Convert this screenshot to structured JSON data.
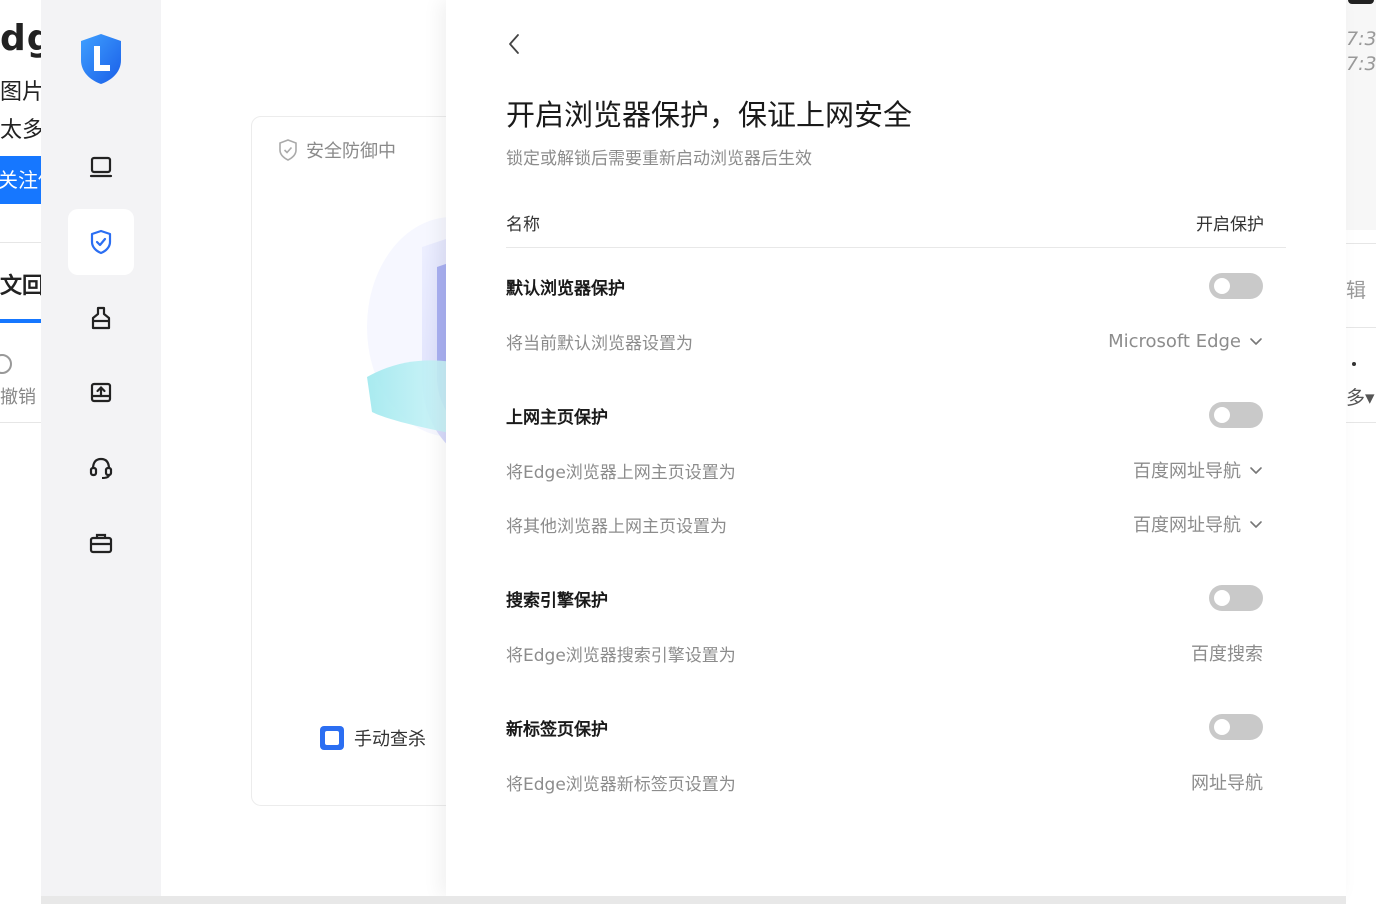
{
  "background_left": {
    "fragment_1": "dge",
    "fragment_2": "图片]",
    "fragment_3": "太多",
    "follow_label": "关注他",
    "fragment_4": "文回答",
    "fragment_5": "撤销"
  },
  "sidebar": {
    "items": [
      {
        "icon": "monitor-icon",
        "active": false
      },
      {
        "icon": "shield-check-icon",
        "active": true
      },
      {
        "icon": "broom-icon",
        "active": false
      },
      {
        "icon": "upload-box-icon",
        "active": false
      },
      {
        "icon": "headset-icon",
        "active": false
      },
      {
        "icon": "toolbox-icon",
        "active": false
      }
    ],
    "accent_color": "#2b6ef2"
  },
  "main_card": {
    "status_label": "安全防御中",
    "manual_scan_label": "手动查杀"
  },
  "panel": {
    "title": "开启浏览器保护，保证上网安全",
    "subtitle": "锁定或解锁后需要重新启动浏览器后生效",
    "header": {
      "name_col": "名称",
      "toggle_col": "开启保护"
    },
    "sections": [
      {
        "title": "默认浏览器保护",
        "enabled": false,
        "rows": [
          {
            "label": "将当前默认浏览器设置为",
            "value": "Microsoft Edge",
            "has_dropdown": true
          }
        ]
      },
      {
        "title": "上网主页保护",
        "enabled": false,
        "rows": [
          {
            "label": "将Edge浏览器上网主页设置为",
            "value": "百度网址导航",
            "has_dropdown": true
          },
          {
            "label": "将其他浏览器上网主页设置为",
            "value": "百度网址导航",
            "has_dropdown": true
          }
        ]
      },
      {
        "title": "搜索引擎保护",
        "enabled": false,
        "rows": [
          {
            "label": "将Edge浏览器搜索引擎设置为",
            "value": "百度搜索",
            "has_dropdown": false
          }
        ]
      },
      {
        "title": "新标签页保护",
        "enabled": false,
        "rows": [
          {
            "label": "将Edge浏览器新标签页设置为",
            "value": "网址导航",
            "has_dropdown": false
          }
        ]
      }
    ]
  },
  "background_right": {
    "time_1": "7:3",
    "time_2": "7:3",
    "fragment_1": "辑",
    "fragment_2": "多▾"
  }
}
